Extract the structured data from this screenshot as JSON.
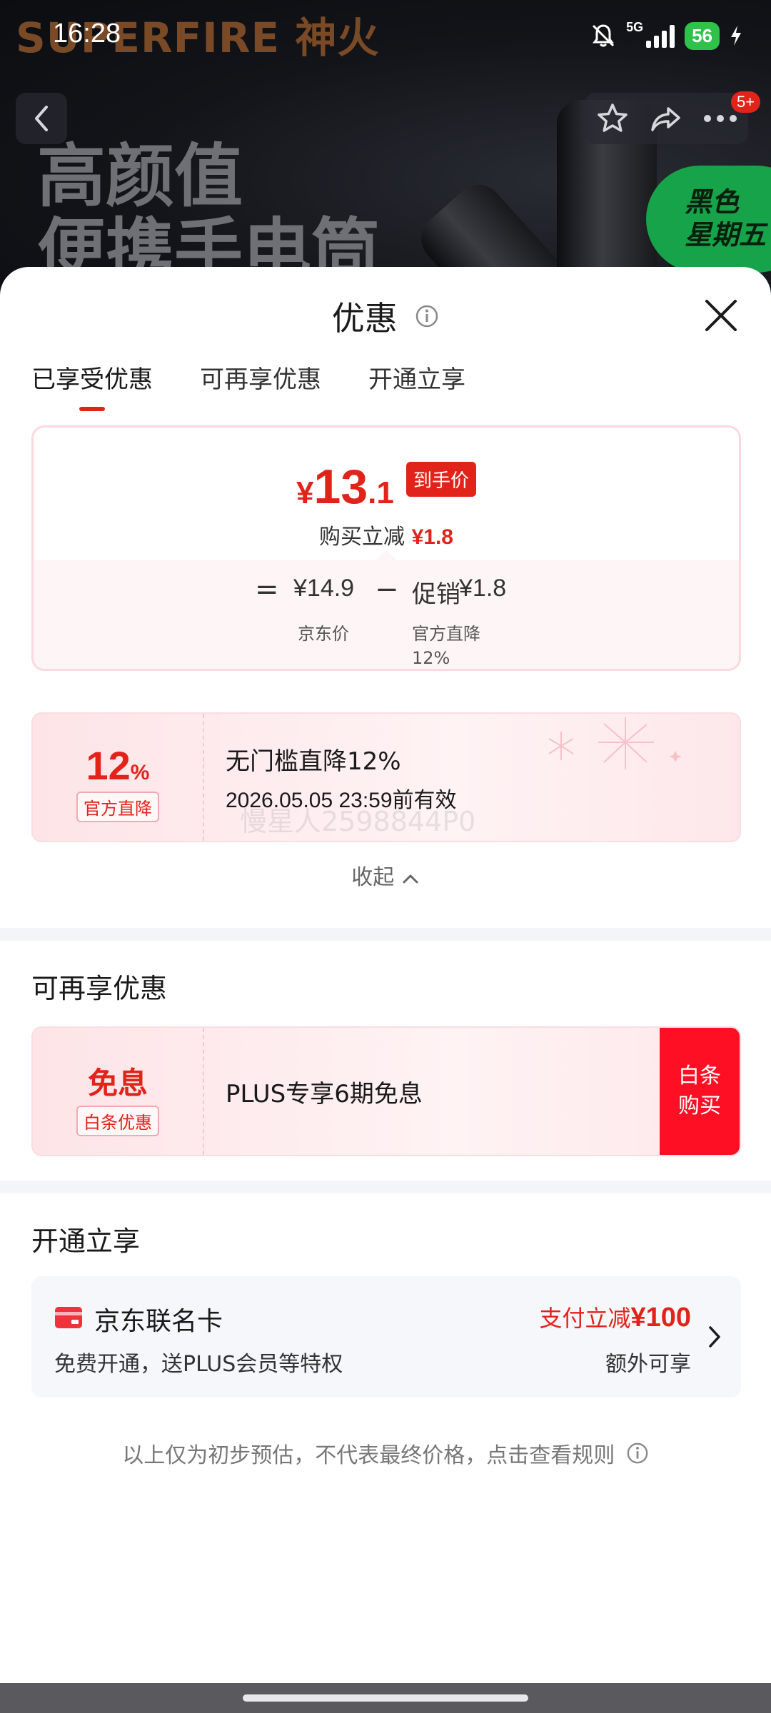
{
  "status_bar": {
    "time": "16:28",
    "network": "5G",
    "battery": "56"
  },
  "banner": {
    "brand": "SUPERFIRE 神火",
    "slogan_line1": "高颜值",
    "slogan_line2": "便携手电筒",
    "promo_badge_line1": "黑色",
    "promo_badge_line2": "星期五",
    "message_badge": "5+"
  },
  "sheet": {
    "title": "优惠"
  },
  "tabs": [
    {
      "label": "已享受优惠",
      "active": true
    },
    {
      "label": "可再享优惠",
      "active": false
    },
    {
      "label": "开通立享",
      "active": false
    }
  ],
  "price": {
    "final_yen": "¥",
    "final_int": "13",
    "final_dec": ".1",
    "final_tag": "到手价",
    "cut_label": "购买立减",
    "cut_value": "¥1.8",
    "equals": "=",
    "jd_price": "¥14.9",
    "minus": "−",
    "promo_label": "促销",
    "promo_value": "¥1.8",
    "jd_price_label": "京东价",
    "promo_sub_label": "官方直降",
    "promo_sub_pct": "12%"
  },
  "coupon_enjoyed": {
    "value": "12",
    "unit": "%",
    "tag": "官方直降",
    "title": "无门槛直降12%",
    "validity": "2026.05.05 23:59前有效",
    "watermark": "慢星人2598844P0"
  },
  "collapse_label": "收起",
  "section_more": {
    "title": "可再享优惠",
    "coupon_value": "免息",
    "coupon_tag": "白条优惠",
    "coupon_title": "PLUS专享6期免息",
    "button_line1": "白条",
    "button_line2": "购买"
  },
  "section_open": {
    "title": "开通立享",
    "card_name": "京东联名卡",
    "card_desc": "免费开通，送PLUS会员等特权",
    "promo_label": "支付立减",
    "promo_amount": "¥100",
    "extra": "额外可享"
  },
  "footnote": "以上仅为初步预估，不代表最终价格，点击查看规则",
  "colors": {
    "accent": "#e2231a",
    "button_red": "#ff0f23",
    "promo_green": "#17a34a"
  }
}
